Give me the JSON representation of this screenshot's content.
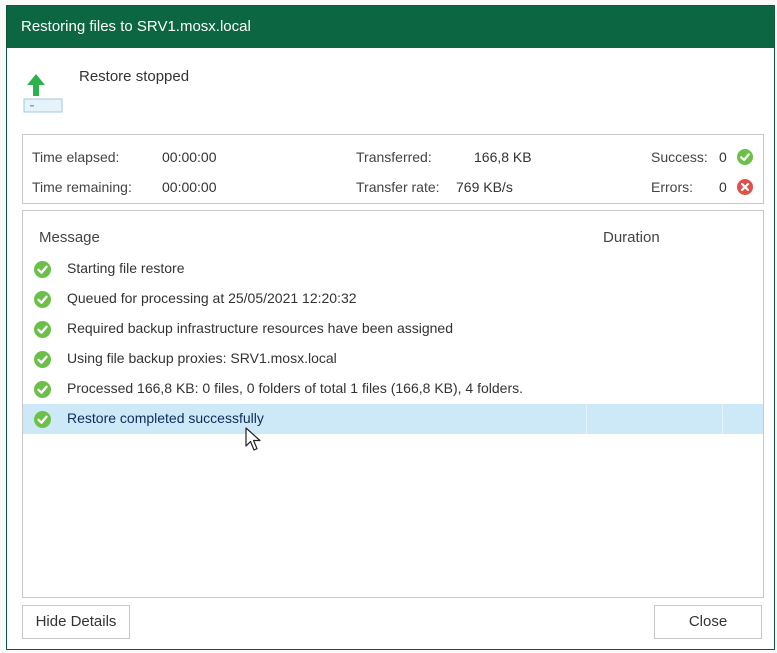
{
  "window": {
    "title": "Restoring files to SRV1.mosx.local"
  },
  "status": {
    "text": "Restore stopped",
    "icon": "upload-arrow-icon"
  },
  "stats": {
    "time_elapsed_label": "Time elapsed:",
    "time_elapsed_value": "00:00:00",
    "time_remaining_label": "Time remaining:",
    "time_remaining_value": "00:00:00",
    "transferred_label": "Transferred:",
    "transferred_value": "166,8 KB",
    "transfer_rate_label": "Transfer rate:",
    "transfer_rate_value": "769 KB/s",
    "success_label": "Success:",
    "success_value": "0",
    "errors_label": "Errors:",
    "errors_value": "0"
  },
  "log": {
    "columns": {
      "message": "Message",
      "duration": "Duration"
    },
    "rows": [
      {
        "message": "Starting file restore",
        "icon": "success-check-icon"
      },
      {
        "message": "Queued for processing at 25/05/2021 12:20:32",
        "icon": "success-check-icon"
      },
      {
        "message": "Required backup infrastructure resources have been assigned",
        "icon": "success-check-icon"
      },
      {
        "message": "Using file backup proxies: SRV1.mosx.local",
        "icon": "success-check-icon"
      },
      {
        "message": "Processed 166,8 KB: 0 files, 0 folders of total 1 files (166,8 KB), 4 folders.",
        "icon": "success-check-icon"
      },
      {
        "message": "Restore completed successfully",
        "icon": "success-check-icon",
        "selected": true
      }
    ]
  },
  "buttons": {
    "hide_details": "Hide Details",
    "close": "Close"
  },
  "colors": {
    "titlebar": "#0d6642",
    "success": "#6cc04a",
    "error": "#e0504a",
    "selection": "#cde8f6",
    "accent_arrow": "#2bb24c"
  }
}
